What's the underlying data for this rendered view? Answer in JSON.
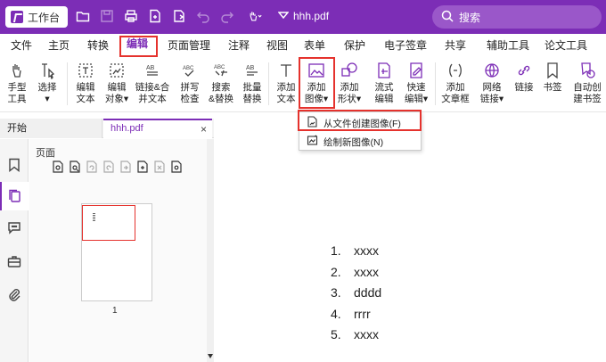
{
  "titlebar": {
    "workspace_label": "工作台",
    "filename": "hhh.pdf",
    "search_placeholder": "搜索"
  },
  "menubar": {
    "items": [
      "文件",
      "主页",
      "转换",
      "编辑",
      "页面管理",
      "注释",
      "视图",
      "表单",
      "保护",
      "电子签章",
      "共享",
      "辅助工具",
      "论文工具"
    ],
    "active": "编辑"
  },
  "ribbon": {
    "buttons": [
      {
        "id": "hand-tool",
        "label": "手型\n工具"
      },
      {
        "id": "select",
        "label": "选择\n▾"
      },
      {
        "id": "edit-text",
        "label": "编辑\n文本"
      },
      {
        "id": "edit-object",
        "label": "编辑\n对象▾"
      },
      {
        "id": "link-merge-text",
        "label": "链接&合\n并文本"
      },
      {
        "id": "spell-check",
        "label": "拼写\n检查"
      },
      {
        "id": "search-replace",
        "label": "搜索\n&替换"
      },
      {
        "id": "batch-replace",
        "label": "批量\n替换"
      },
      {
        "id": "add-text",
        "label": "添加\n文本"
      },
      {
        "id": "add-image",
        "label": "添加\n图像▾"
      },
      {
        "id": "add-shape",
        "label": "添加\n形状▾"
      },
      {
        "id": "flow-edit",
        "label": "流式\n编辑"
      },
      {
        "id": "quick-edit",
        "label": "快速\n编辑▾"
      },
      {
        "id": "add-textbox",
        "label": "添加\n文章框"
      },
      {
        "id": "web-link",
        "label": "网络\n链接▾"
      },
      {
        "id": "link",
        "label": "链接"
      },
      {
        "id": "bookmark",
        "label": "书签"
      },
      {
        "id": "auto-bookmark",
        "label": "自动创\n建书签"
      }
    ]
  },
  "add_image_menu": {
    "items": [
      {
        "label": "从文件创建图像(F)"
      },
      {
        "label": "绘制新图像(N)"
      }
    ]
  },
  "tabs": {
    "start": "开始",
    "file": "hhh.pdf"
  },
  "panel": {
    "title": "页面",
    "page_number": "1"
  },
  "document": {
    "list": [
      {
        "num": "1.",
        "text": "xxxx"
      },
      {
        "num": "2.",
        "text": "xxxx"
      },
      {
        "num": "3.",
        "text": "dddd"
      },
      {
        "num": "4.",
        "text": "rrrr"
      },
      {
        "num": "5.",
        "text": "xxxx"
      }
    ]
  },
  "colors": {
    "brand": "#7c2db6",
    "highlight": "#e5322d"
  }
}
